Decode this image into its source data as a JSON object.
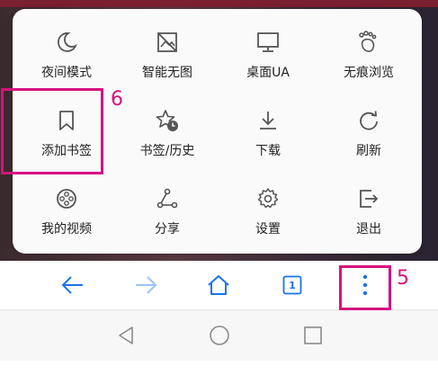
{
  "menu": {
    "items": [
      {
        "label": "夜间模式",
        "icon": "moon-icon"
      },
      {
        "label": "智能无图",
        "icon": "no-image-icon"
      },
      {
        "label": "桌面UA",
        "icon": "desktop-monitor-icon"
      },
      {
        "label": "无痕浏览",
        "icon": "footprints-icon"
      },
      {
        "label": "添加书签",
        "icon": "bookmark-icon"
      },
      {
        "label": "书签/历史",
        "icon": "star-clock-icon"
      },
      {
        "label": "下载",
        "icon": "download-icon"
      },
      {
        "label": "刷新",
        "icon": "refresh-icon"
      },
      {
        "label": "我的视频",
        "icon": "film-reel-icon"
      },
      {
        "label": "分享",
        "icon": "share-icon"
      },
      {
        "label": "设置",
        "icon": "gear-icon"
      },
      {
        "label": "退出",
        "icon": "exit-icon"
      }
    ]
  },
  "toolbar": {
    "tab_count": "1",
    "buttons": [
      "back-arrow-icon",
      "forward-arrow-icon",
      "home-icon",
      "tabs-icon",
      "more-vertical-icon"
    ]
  },
  "annotations": {
    "bookmark_step": "6",
    "menu_step": "5"
  },
  "colors": {
    "accent_blue": "#1a73e8",
    "annotation_magenta": "#d6127f",
    "icon_gray": "#555555"
  }
}
